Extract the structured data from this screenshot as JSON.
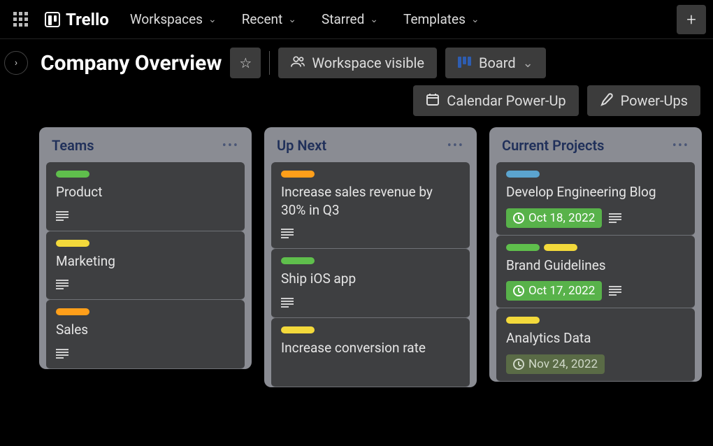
{
  "nav": {
    "brand": "Trello",
    "items": [
      "Workspaces",
      "Recent",
      "Starred",
      "Templates"
    ]
  },
  "board": {
    "title": "Company Overview",
    "visibility": "Workspace visible",
    "view": "Board",
    "powerups": {
      "calendar": "Calendar Power-Up",
      "main": "Power-Ups"
    }
  },
  "lists": [
    {
      "title": "Teams",
      "cards": [
        {
          "labels": [
            "green"
          ],
          "title": "Product",
          "has_desc": true
        },
        {
          "labels": [
            "yellow"
          ],
          "title": "Marketing",
          "has_desc": true
        },
        {
          "labels": [
            "orange"
          ],
          "title": "Sales",
          "has_desc": true
        }
      ]
    },
    {
      "title": "Up Next",
      "cards": [
        {
          "labels": [
            "orange"
          ],
          "title": "Increase sales revenue by 30% in Q3",
          "has_desc": true
        },
        {
          "labels": [
            "green"
          ],
          "title": "Ship iOS app",
          "has_desc": true
        },
        {
          "labels": [
            "yellow"
          ],
          "title": "Increase conversion rate"
        }
      ]
    },
    {
      "title": "Current Projects",
      "cards": [
        {
          "labels": [
            "blue"
          ],
          "title": "Develop Engineering Blog",
          "due": "Oct 18, 2022",
          "due_state": "done",
          "has_desc": true
        },
        {
          "labels": [
            "green",
            "yellow"
          ],
          "title": "Brand Guidelines",
          "due": "Oct 17, 2022",
          "due_state": "done",
          "has_desc": true
        },
        {
          "labels": [
            "yellow"
          ],
          "title": "Analytics Data",
          "due": "Nov 24, 2022",
          "due_state": "pending"
        }
      ]
    }
  ]
}
